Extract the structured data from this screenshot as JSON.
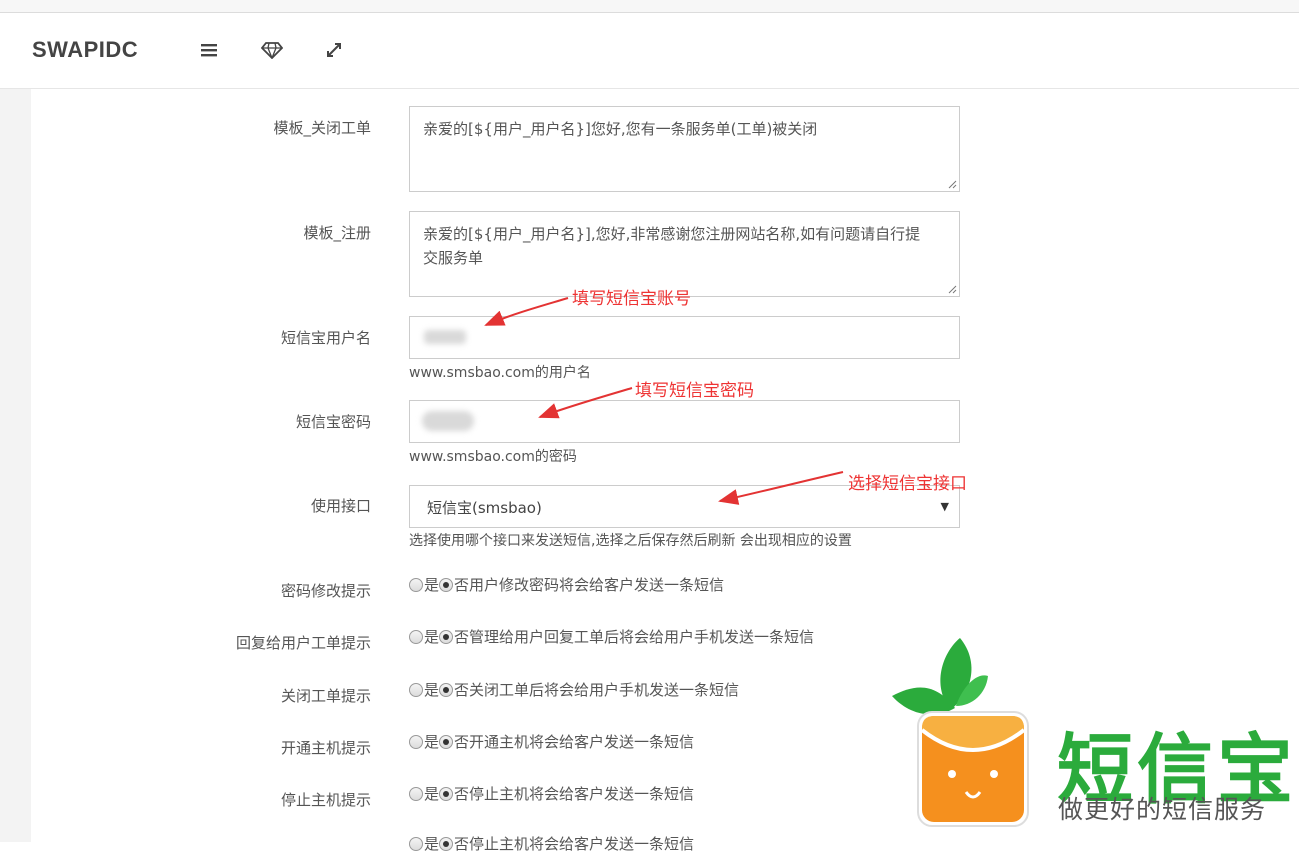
{
  "header": {
    "brand": "SWAPIDC",
    "icons": [
      "menu-icon",
      "diamond-icon",
      "expand-icon"
    ]
  },
  "form": {
    "tpl_close_ticket": {
      "label": "模板_关闭工单",
      "value": "亲爱的[${用户_用户名}]您好,您有一条服务单(工单)被关闭"
    },
    "tpl_register": {
      "label": "模板_注册",
      "value_line1": "亲爱的[${用户_用户名}],您好,非常感谢您注册网站名称,如有问题请自行提",
      "value_line2": "交服务单"
    },
    "username": {
      "label": "短信宝用户名",
      "help": "www.smsbao.com的用户名"
    },
    "password": {
      "label": "短信宝密码",
      "help": "www.smsbao.com的密码"
    },
    "interface": {
      "label": "使用接口",
      "selected": "短信宝(smsbao)",
      "help": "选择使用哪个接口来发送短信,选择之后保存然后刷新 会出现相应的设置"
    },
    "radio_yes": "是",
    "radio_no": "否",
    "notices": [
      {
        "label": "密码修改提示",
        "desc": "用户修改密码将会给客户发送一条短信"
      },
      {
        "label": "回复给用户工单提示",
        "desc": "管理给用户回复工单后将会给用户手机发送一条短信"
      },
      {
        "label": "关闭工单提示",
        "desc": "关闭工单后将会给用户手机发送一条短信"
      },
      {
        "label": "开通主机提示",
        "desc": "开通主机将会给客户发送一条短信"
      },
      {
        "label": "停止主机提示",
        "desc": "停止主机将会给客户发送一条短信"
      },
      {
        "label": "",
        "desc": "停止主机将会给客户发送一条短信"
      }
    ]
  },
  "annotations": {
    "username": "填写短信宝账号",
    "password": "填写短信宝密码",
    "interface": "选择短信宝接口"
  },
  "logo": {
    "name": "短信宝",
    "slogan": "做更好的短信服务"
  },
  "colors": {
    "annotation": "#e33333",
    "logo_green": "#2bab3c",
    "logo_orange": "#f5901e"
  }
}
